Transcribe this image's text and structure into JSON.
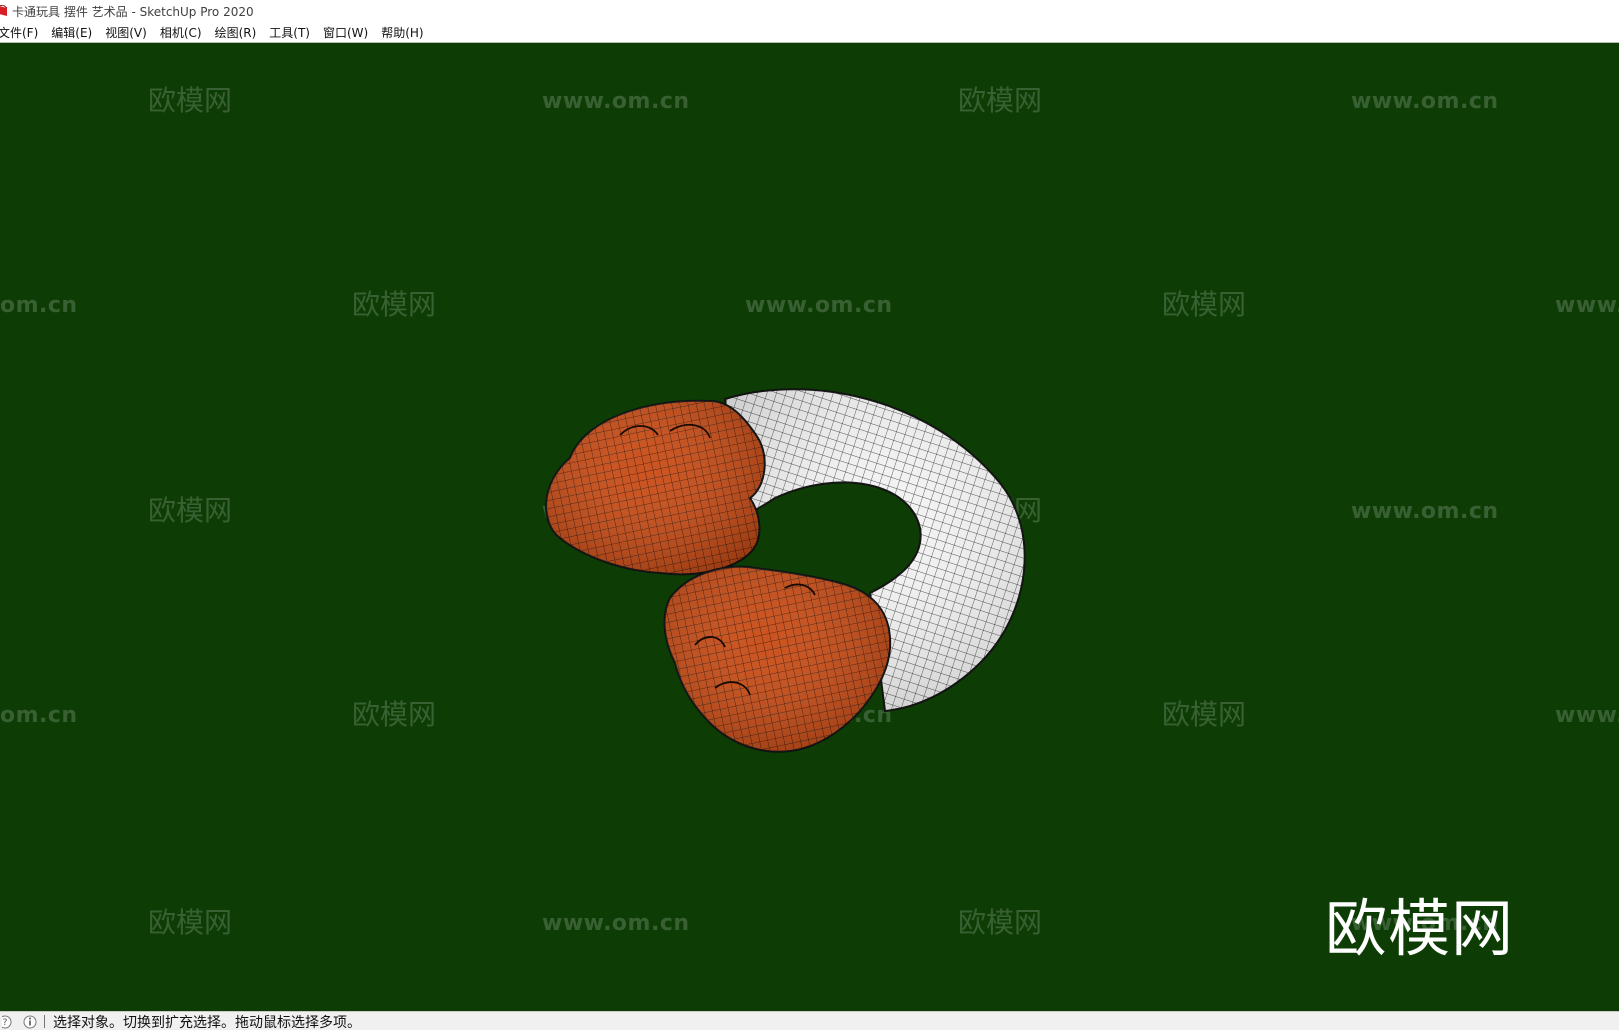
{
  "window": {
    "title": "卡通玩具 摆件 艺术品 - SketchUp Pro 2020",
    "app_icon": "sketchup-logo-icon"
  },
  "menubar": {
    "items": [
      "文件(F)",
      "编辑(E)",
      "视图(V)",
      "相机(C)",
      "绘图(R)",
      "工具(T)",
      "窗口(W)",
      "帮助(H)"
    ]
  },
  "viewport": {
    "background": "#0d3d05",
    "watermark_logo_text": "欧模网",
    "watermark_url_text": "www.om.cn",
    "watermark_url_partial_left": "om.cn",
    "watermark_url_partial_right": "www.",
    "big_logo_text": "欧模网",
    "model": {
      "description_colors": {
        "orange": "#c94a13",
        "white": "#f5f5f5",
        "mesh_line": "#111111"
      }
    }
  },
  "statusbar": {
    "icons": [
      "help-circle-icon",
      "info-icon"
    ],
    "text": "选择对象。切换到扩充选择。拖动鼠标选择多项。"
  }
}
